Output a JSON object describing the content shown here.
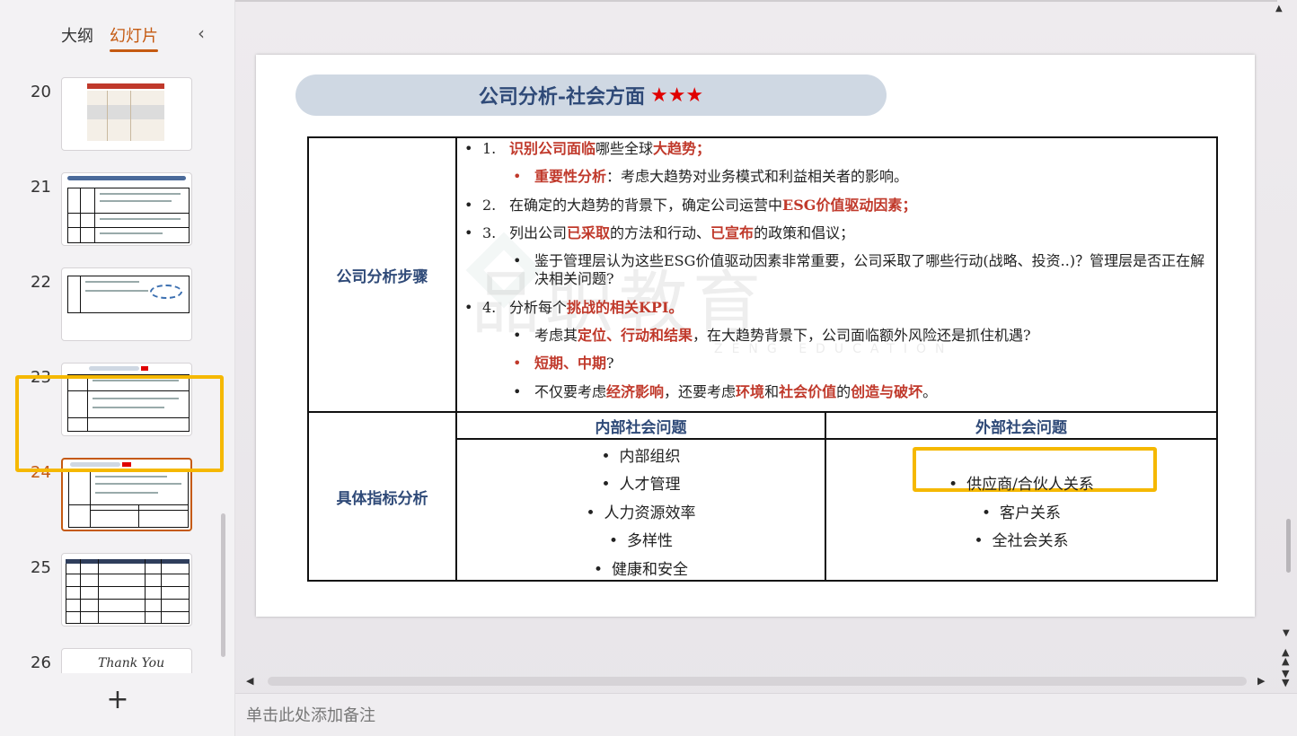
{
  "sidebar": {
    "tabs": [
      {
        "label": "大纲",
        "active": false
      },
      {
        "label": "幻灯片",
        "active": true
      }
    ],
    "collapse_icon": "chevron-left-icon",
    "thumbnails": [
      {
        "number": "20"
      },
      {
        "number": "21"
      },
      {
        "number": "22"
      },
      {
        "number": "23"
      },
      {
        "number": "24",
        "selected": true
      },
      {
        "number": "25"
      },
      {
        "number": "26",
        "text": "Thank You"
      }
    ],
    "add_icon": "plus-icon"
  },
  "slide": {
    "title": "公司分析-社会方面",
    "stars": "★★★",
    "watermark": "品职教育",
    "watermark_sub": "ZENG EDUCATION",
    "steps_label": "公司分析步骤",
    "indicator_label": "具体指标分析",
    "steps": [
      {
        "num": "1.",
        "segments": [
          {
            "t": "识别公司面临",
            "s": "red"
          },
          {
            "t": "哪些全球"
          },
          {
            "t": "大趋势",
            "s": "red"
          },
          {
            "t": "；",
            "s": "red"
          }
        ]
      },
      {
        "sub": true,
        "bullet_red": true,
        "segments": [
          {
            "t": "重要性分析",
            "s": "red"
          },
          {
            "t": "：考虑大趋势对业务模式和利益相关者的影响。"
          }
        ]
      },
      {
        "num": "2.",
        "segments": [
          {
            "t": "在确定的大趋势的背景下，确定公司运营中"
          },
          {
            "t": "ESG价值驱动因素",
            "s": "red"
          },
          {
            "t": "；",
            "s": "red"
          }
        ]
      },
      {
        "num": "3.",
        "segments": [
          {
            "t": "列出公司"
          },
          {
            "t": "已采取",
            "s": "red"
          },
          {
            "t": "的方法和行动、"
          },
          {
            "t": "已宣布",
            "s": "red"
          },
          {
            "t": "的政策和倡议；"
          }
        ]
      },
      {
        "sub": true,
        "segments": [
          {
            "t": "鉴于管理层认为这些ESG价值驱动因素非常重要，公司采取了哪些行动(战略、投资..)？管理层是否正在解决相关问题?"
          }
        ]
      },
      {
        "num": "4.",
        "segments": [
          {
            "t": "分析每个"
          },
          {
            "t": "挑战的相关KPI。",
            "s": "red"
          }
        ]
      },
      {
        "sub": true,
        "segments": [
          {
            "t": "考虑其"
          },
          {
            "t": "定位、行动和结果",
            "s": "red"
          },
          {
            "t": "，在大趋势背景下，公司面临额外风险还是抓住机遇?"
          }
        ]
      },
      {
        "sub": true,
        "bullet_red": true,
        "segments": [
          {
            "t": "短期、中期",
            "s": "red"
          },
          {
            "t": "?"
          }
        ]
      },
      {
        "sub": true,
        "segments": [
          {
            "t": "不仅要考虑"
          },
          {
            "t": "经济影响",
            "s": "red"
          },
          {
            "t": "，还要考虑"
          },
          {
            "t": "环境",
            "s": "red"
          },
          {
            "t": "和"
          },
          {
            "t": "社会价值",
            "s": "red"
          },
          {
            "t": "的"
          },
          {
            "t": "创造与破坏",
            "s": "red"
          },
          {
            "t": "。"
          }
        ]
      }
    ],
    "internal": {
      "header": "内部社会问题",
      "items": [
        "内部组织",
        "人才管理",
        "人力资源效率",
        "多样性",
        "健康和安全"
      ]
    },
    "external": {
      "header": "外部社会问题",
      "items": [
        "供应商/合伙人关系",
        "客户关系",
        "全社会关系"
      ]
    }
  },
  "notes": {
    "placeholder": "单击此处添加备注"
  },
  "colors": {
    "accent": "#c55a11",
    "highlight": "#f5b800",
    "title_bg": "#cfd8e3",
    "title_text": "#2f4a78",
    "emphasis": "#c0392b"
  }
}
